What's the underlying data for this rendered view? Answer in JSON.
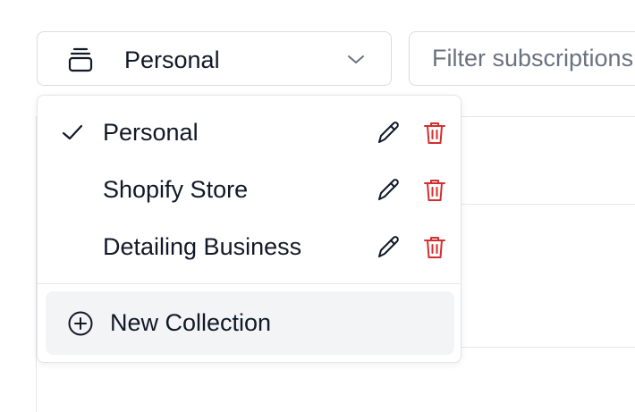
{
  "selector": {
    "label": "Personal",
    "icon": "collection-stack-icon",
    "chevron": "chevron-down-icon"
  },
  "filter": {
    "placeholder": "Filter subscriptions",
    "value": ""
  },
  "menu": {
    "items": [
      {
        "label": "Personal",
        "selected": true
      },
      {
        "label": "Shopify Store",
        "selected": false
      },
      {
        "label": "Detailing Business",
        "selected": false
      }
    ],
    "new_collection_label": "New Collection"
  },
  "colors": {
    "danger": "#d32f2f",
    "text": "#111827",
    "muted": "#6b7280",
    "hover_bg": "#f3f4f6"
  }
}
